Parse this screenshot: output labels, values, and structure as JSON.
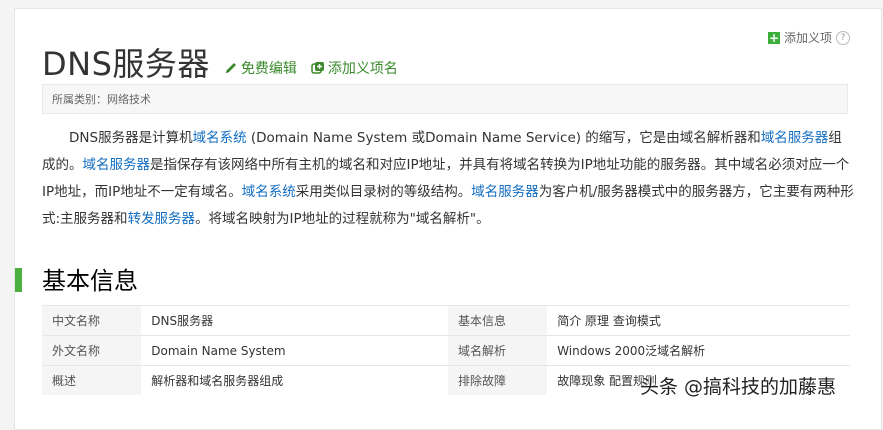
{
  "top_add_label": "添加义项",
  "title": "DNS服务器",
  "edit_label": "免费编辑",
  "add_link_label": "添加义项名",
  "category_label": "所属类别：",
  "category_value": "网络技术",
  "paragraph": {
    "s1": "DNS服务器是计算机",
    "l1": "域名系统",
    "s2": " (Domain Name System 或Domain Name Service) 的缩写，它是由域名解析器和",
    "l2": "域名服务器",
    "s3": "组成的。",
    "l3": "域名服务器",
    "s4": "是指保存有该网络中所有主机的域名和对应IP地址，并具有将域名转换为IP地址功能的服务器。其中域名必须对应一个IP地址，而IP地址不一定有域名。",
    "l4": "域名系统",
    "s5": "采用类似目录树的等级结构。",
    "l5": "域名服务器",
    "s6": "为客户机/服务器模式中的服务器方，它主要有两种形式:主服务器和",
    "l6": "转发服务器",
    "s7": "。将域名映射为IP地址的过程就称为\"域名解析\"。"
  },
  "section_title": "基本信息",
  "info_rows": [
    {
      "k1": "中文名称",
      "v1": "DNS服务器",
      "k2": "基本信息",
      "v2": "简介 原理 查询模式"
    },
    {
      "k1": "外文名称",
      "v1": "Domain Name System",
      "k2": "域名解析",
      "v2": "Windows 2000泛域名解析"
    },
    {
      "k1": "概述",
      "v1": "解析器和域名服务器组成",
      "k2": "排除故障",
      "v2": "故障现象 配置规则"
    }
  ],
  "watermark": "头条 @搞科技的加藤惠"
}
